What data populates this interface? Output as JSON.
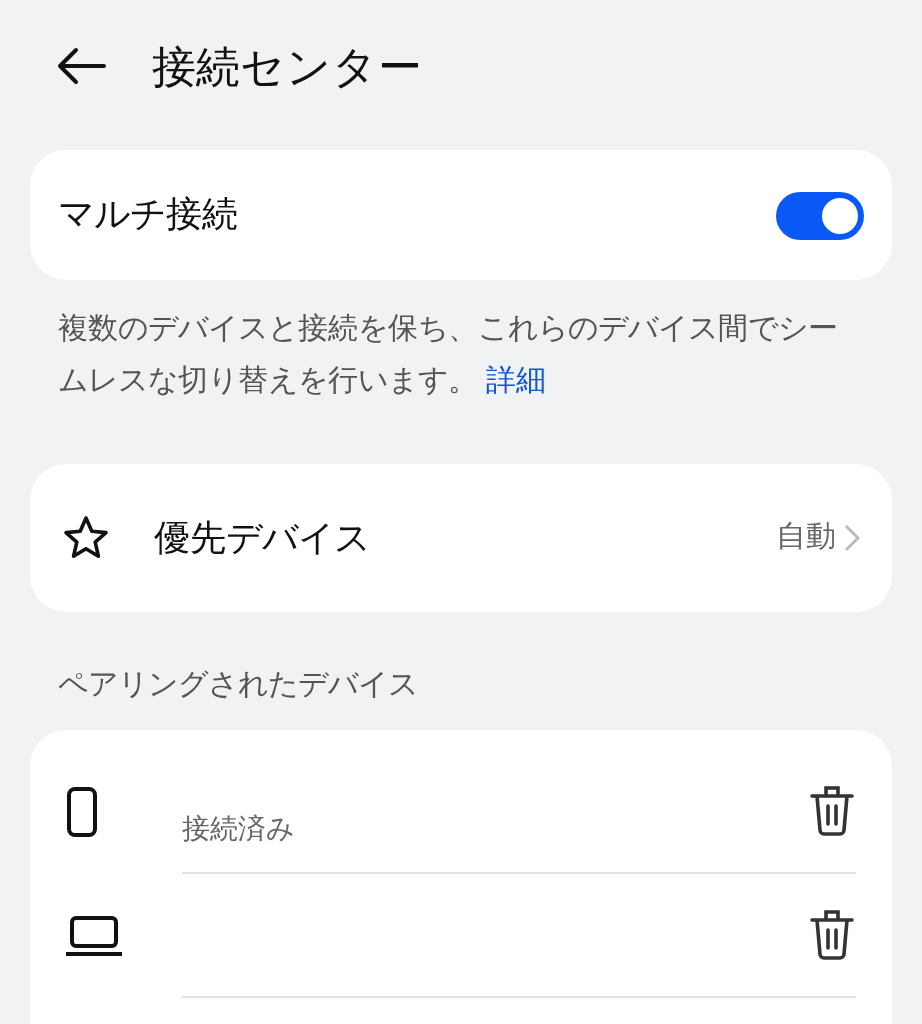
{
  "header": {
    "title": "接続センター"
  },
  "multi_connection": {
    "label": "マルチ接続",
    "on": true
  },
  "description": {
    "text": "複数のデバイスと接続を保ち、これらのデバイス間でシームレスな切り替えを行います。",
    "link": "詳細"
  },
  "preferred_device": {
    "label": "優先デバイス",
    "value": "自動"
  },
  "paired_devices": {
    "title": "ペアリングされたデバイス",
    "items": [
      {
        "kind": "phone",
        "status": "接続済み"
      },
      {
        "kind": "laptop"
      }
    ]
  }
}
